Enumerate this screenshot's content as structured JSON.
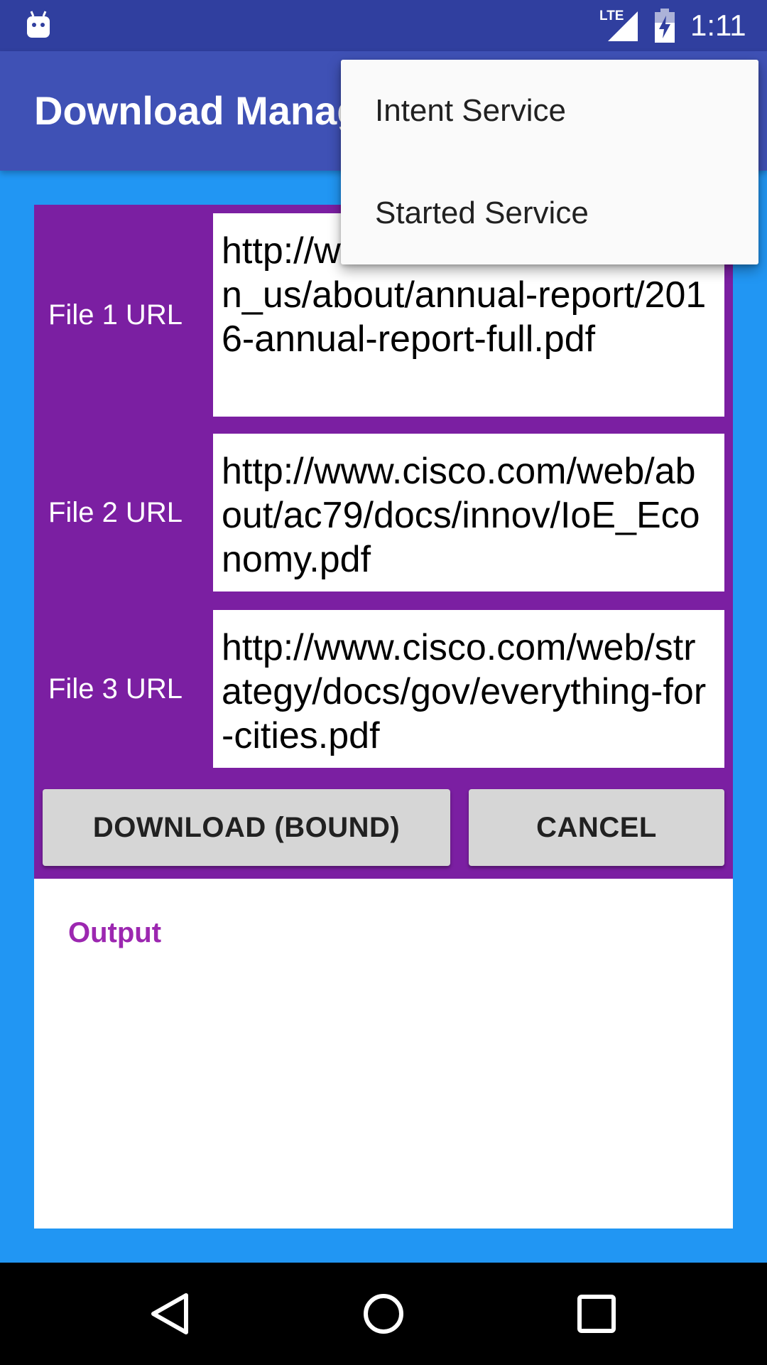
{
  "status_bar": {
    "network": "LTE",
    "time": "1:11"
  },
  "app_bar": {
    "title": "Download Manager"
  },
  "files": [
    {
      "label": "File 1 URL",
      "value": "http://www.cisco.com/c/dam/en_us/about/annual-report/2016-annual-report-full.pdf"
    },
    {
      "label": "File 2 URL",
      "value": "http://www.cisco.com/web/about/ac79/docs/innov/IoE_Economy.pdf"
    },
    {
      "label": "File 3 URL",
      "value": "http://www.cisco.com/web/strategy/docs/gov/everything-for-cities.pdf"
    }
  ],
  "actions": {
    "download_label": "DOWNLOAD (BOUND)",
    "cancel_label": "CANCEL"
  },
  "output": {
    "label": "Output"
  },
  "overflow_menu": {
    "items": [
      {
        "label": "Intent Service"
      },
      {
        "label": "Started Service"
      }
    ]
  },
  "nav_bar": {
    "icons": [
      "back-icon",
      "home-icon",
      "recents-icon"
    ]
  },
  "colors": {
    "status_bar": "#303F9F",
    "app_bar": "#3F51B5",
    "background": "#2196F3",
    "form_panel": "#7B1FA2",
    "output_label": "#9C27B0",
    "button": "#D6D6D6"
  }
}
